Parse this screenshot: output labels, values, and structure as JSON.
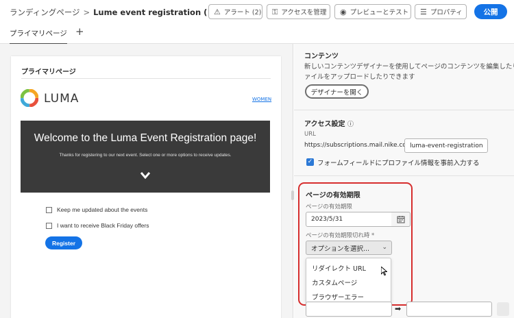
{
  "header": {
    "breadcrumb_root": "ランディングページ",
    "breadcrumb_sep": ">",
    "page_title": "Lume event registration (ドラフト)",
    "buttons": {
      "alerts": "アラート (2)",
      "access": "アクセスを管理",
      "preview": "プレビューとテスト",
      "properties": "プロパティ",
      "publish": "公開"
    }
  },
  "tabs": {
    "primary": "プライマリページ",
    "add": "+"
  },
  "canvas": {
    "section_title": "プライマリページ",
    "brand": "LUMA",
    "nav_link": "WOMEN",
    "hero_title": "Welcome to the Luma Event Registration page!",
    "hero_subtitle": "Thanks for registering to our next event. Select one or more options to receive updates.",
    "option1": "Keep me updated about the events",
    "option2": "I want to receive Black Friday offers",
    "register": "Register"
  },
  "panel": {
    "content": {
      "title": "コンテンツ",
      "desc_line1": "新しいコンテンツデザイナーを使用してページのコンテンツを編集したり、",
      "desc_line2": "ァイルをアップロードしたりできます",
      "open_designer": "デザイナーを開く"
    },
    "access": {
      "title": "アクセス設定",
      "url_label": "URL",
      "url_prefix": "https://subscriptions.mail.nike.com/lp/",
      "url_slug": "luma-event-registration",
      "prefill_label": "フォームフィールドにプロファイル情報を事前入力する"
    },
    "expiration": {
      "title": "ページの有効期限",
      "date_label": "ページの有効期限",
      "date_value": "2023/5/31",
      "on_expire_label": "ページの有効期限切れ時 *",
      "select_placeholder": "オプションを選択...",
      "options": [
        "リダイレクト URL",
        "カスタムページ",
        "ブラウザーエラー"
      ]
    }
  },
  "colors": {
    "accent": "#1473e6",
    "highlight": "#d62d2d"
  }
}
